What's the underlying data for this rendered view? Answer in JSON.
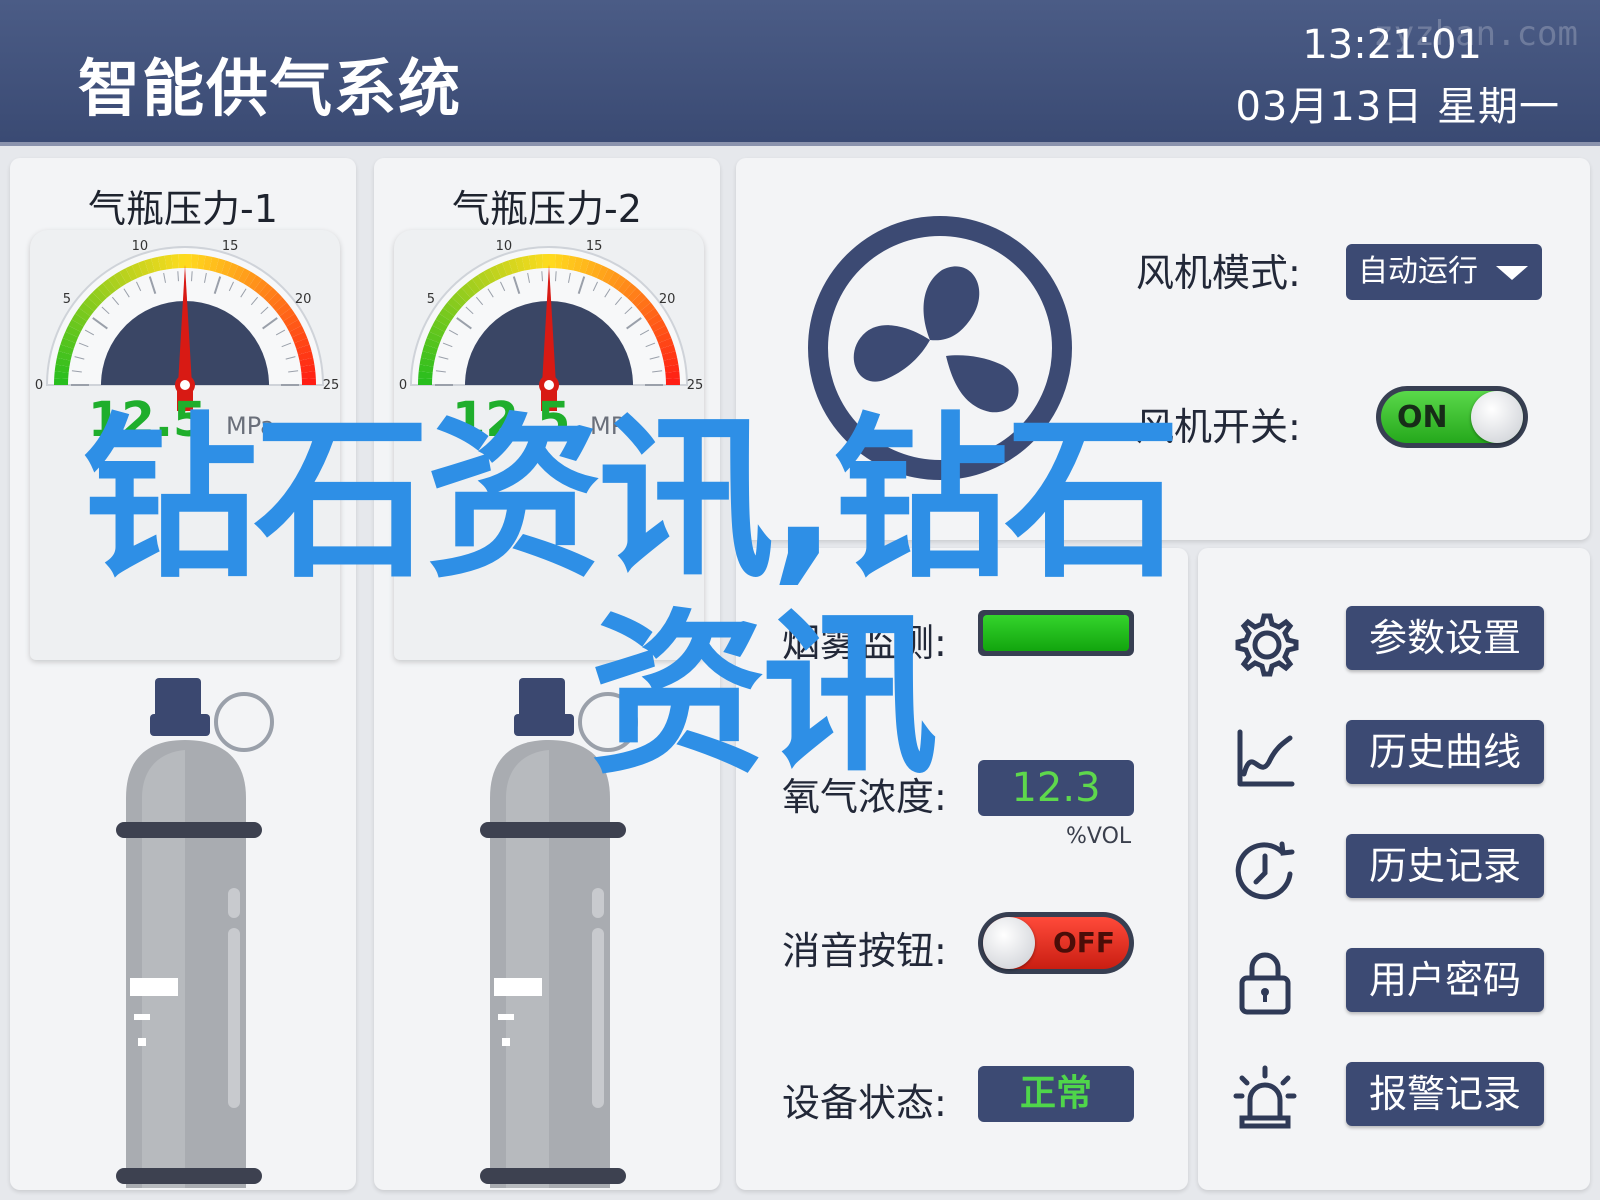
{
  "header": {
    "title": "智能供气系统",
    "time": "13:21:01",
    "date": "03月13日  星期一",
    "site_watermark": "zyzhan.com"
  },
  "gauges": [
    {
      "title": "气瓶压力-1",
      "value": "12.5",
      "unit": "MPa",
      "reading": 12.5,
      "scale_min": 0,
      "scale_max": 25,
      "ticks": [
        "0",
        "5",
        "10",
        "15",
        "20",
        "25"
      ]
    },
    {
      "title": "气瓶压力-2",
      "value": "12.5",
      "unit": "MPa",
      "reading": 12.5,
      "scale_min": 0,
      "scale_max": 25,
      "ticks": [
        "0",
        "5",
        "10",
        "15",
        "20",
        "25"
      ]
    }
  ],
  "fan": {
    "icon": "fan-icon",
    "mode_label": "风机模式:",
    "mode_value": "自动运行",
    "switch_label": "风机开关:",
    "switch_state": "ON"
  },
  "status": {
    "smoke_label": "烟雾监测:",
    "oxygen_label": "氧气浓度:",
    "oxygen_value": "12.3",
    "oxygen_unit": "%VOL",
    "mute_label": "消音按钮:",
    "mute_state": "OFF",
    "device_label": "设备状态:",
    "device_value": "正常"
  },
  "menu": [
    {
      "icon": "gear-icon",
      "label": "参数设置"
    },
    {
      "icon": "line-chart-icon",
      "label": "历史曲线"
    },
    {
      "icon": "clock-icon",
      "label": "历史记录"
    },
    {
      "icon": "lock-icon",
      "label": "用户密码"
    },
    {
      "icon": "alarm-light-icon",
      "label": "报警记录"
    }
  ],
  "overlay": {
    "line1": "钻石资讯,钻石",
    "line2": "资讯"
  },
  "colors": {
    "header_bg": "#3d4d78",
    "button_bg": "#3c4a73",
    "value_green": "#5ed84c",
    "switch_on": "#2fb526",
    "switch_off": "#e0281a",
    "overlay_blue": "#2e8fe6"
  }
}
